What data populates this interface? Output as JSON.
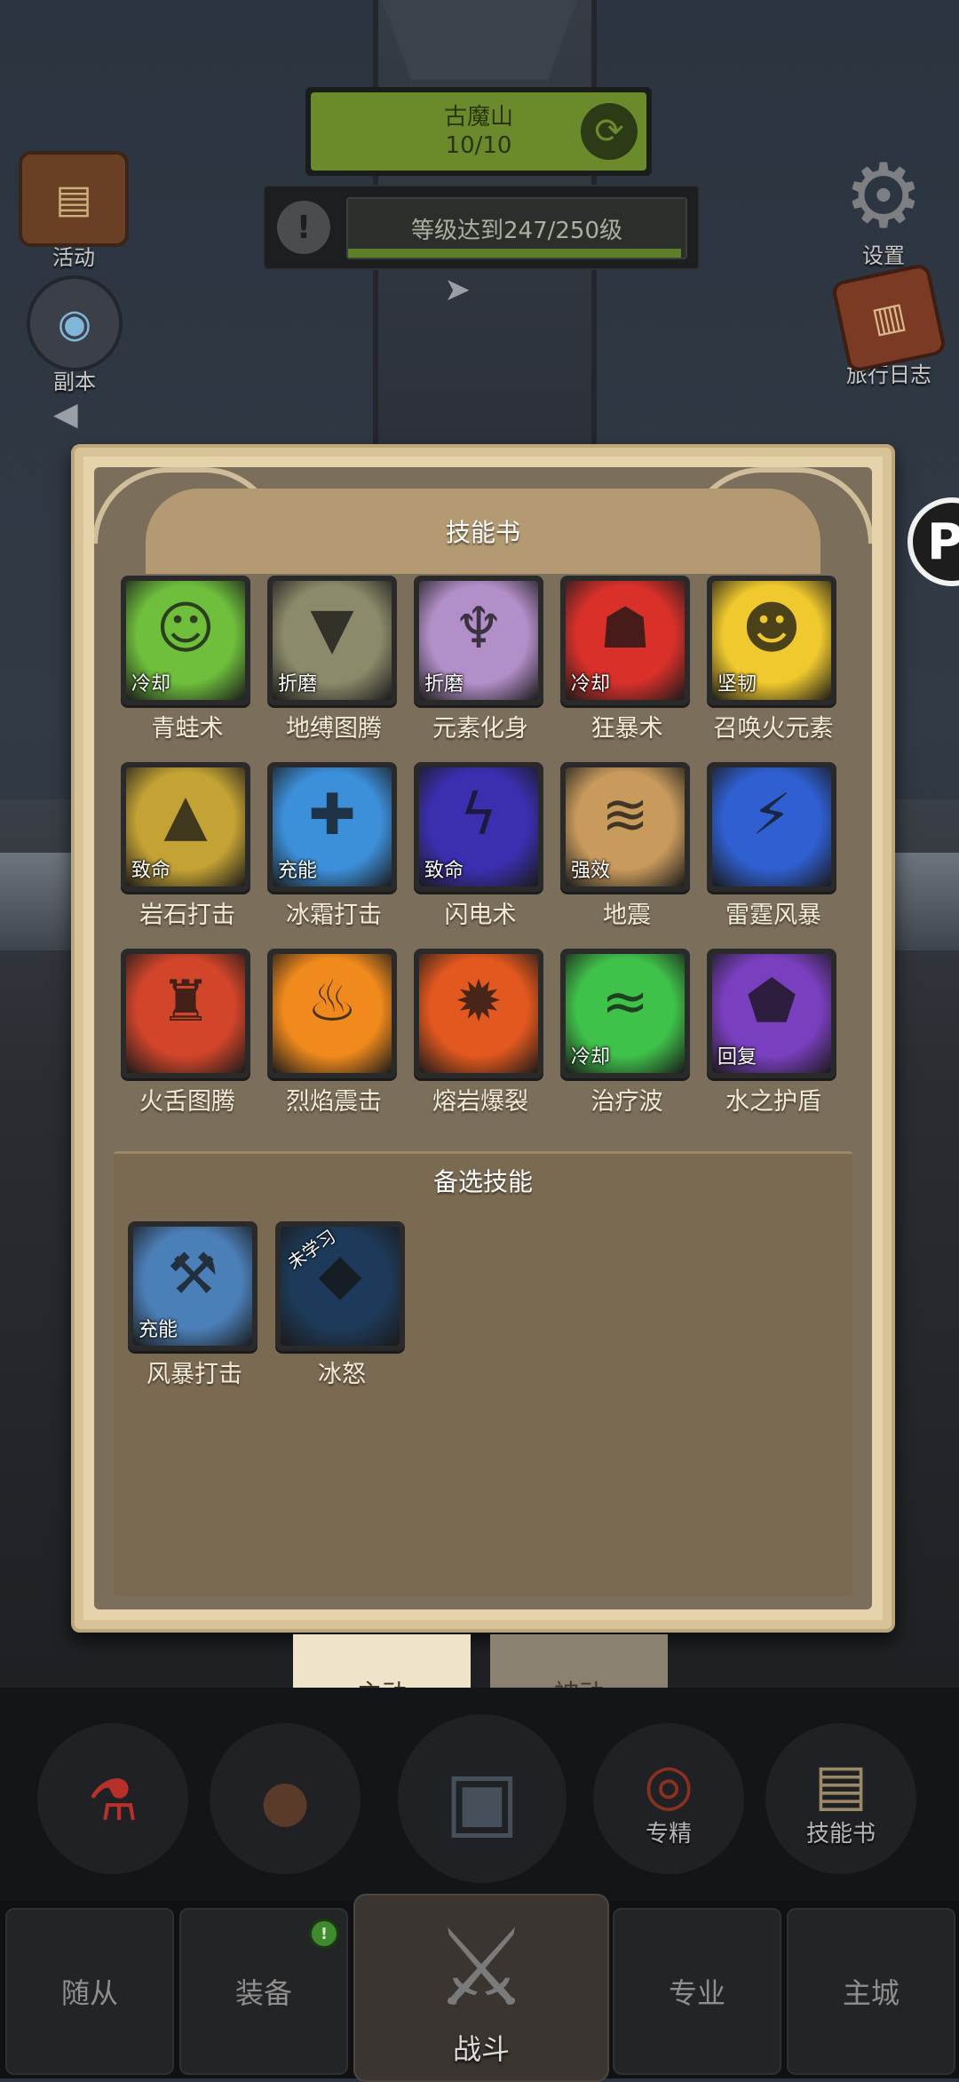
{
  "hud": {
    "stage_name": "古魔山",
    "stage_progress": "10/10",
    "quest_text": "等级达到247/250级",
    "quest_progress_fraction": 0.988
  },
  "side_menu": {
    "left": [
      {
        "label": "活动",
        "icon": "event-scroll-icon"
      },
      {
        "label": "副本",
        "icon": "dungeon-portal-icon"
      }
    ],
    "right": [
      {
        "label": "设置",
        "icon": "gear-icon"
      },
      {
        "label": "旅行日志",
        "icon": "journal-book-icon"
      }
    ]
  },
  "panel": {
    "title": "技能书",
    "alt_title": "备选技能"
  },
  "skills": [
    {
      "name": "青蛙术",
      "tag": "冷却",
      "icon": "frog-icon",
      "color": "#6fbf3c"
    },
    {
      "name": "地缚图腾",
      "tag": "折磨",
      "icon": "earthbind-totem-icon",
      "color": "#8b8a6a"
    },
    {
      "name": "元素化身",
      "tag": "折磨",
      "icon": "elemental-avatar-icon",
      "color": "#b38fc9"
    },
    {
      "name": "狂暴术",
      "tag": "冷却",
      "icon": "bloodlust-mask-icon",
      "color": "#d9302a"
    },
    {
      "name": "召唤火元素",
      "tag": "坚韧",
      "icon": "fire-elemental-icon",
      "color": "#f0c92e"
    },
    {
      "name": "岩石打击",
      "tag": "致命",
      "icon": "rock-strike-icon",
      "color": "#c4a234"
    },
    {
      "name": "冰霜打击",
      "tag": "充能",
      "icon": "frost-strike-icon",
      "color": "#3c8fd9"
    },
    {
      "name": "闪电术",
      "tag": "致命",
      "icon": "lightning-bolt-icon",
      "color": "#3b2fb0"
    },
    {
      "name": "地震",
      "tag": "强效",
      "icon": "earthquake-icon",
      "color": "#c89a5c"
    },
    {
      "name": "雷霆风暴",
      "tag": "",
      "icon": "thunderstorm-icon",
      "color": "#2f5fd0"
    },
    {
      "name": "火舌图腾",
      "tag": "",
      "icon": "flametongue-totem-icon",
      "color": "#d2452a"
    },
    {
      "name": "烈焰震击",
      "tag": "",
      "icon": "flame-shock-icon",
      "color": "#f08a1c"
    },
    {
      "name": "熔岩爆裂",
      "tag": "",
      "icon": "lava-burst-icon",
      "color": "#e2581e"
    },
    {
      "name": "治疗波",
      "tag": "冷却",
      "icon": "healing-wave-icon",
      "color": "#3fc24a"
    },
    {
      "name": "水之护盾",
      "tag": "回复",
      "icon": "water-shield-icon",
      "color": "#7a3fbf"
    }
  ],
  "alt_skills": [
    {
      "name": "风暴打击",
      "tag": "充能",
      "icon": "storm-hammer-icon",
      "color": "#4b7fb8"
    },
    {
      "name": "冰怒",
      "tag": "未学习",
      "icon": "ice-shard-icon",
      "color": "#1e3a5a"
    }
  ],
  "tabs": {
    "active": "主动",
    "passive": "被动"
  },
  "actions": [
    {
      "label": "",
      "icon": "potion-icon"
    },
    {
      "label": "",
      "icon": "bread-icon"
    },
    {
      "label": "",
      "icon": "treasure-chest-icon"
    },
    {
      "label": "专精",
      "icon": "specialization-icon"
    },
    {
      "label": "技能书",
      "icon": "skill-book-icon"
    }
  ],
  "bottom_nav": {
    "followers": "随从",
    "equipment": "装备",
    "equipment_badge": "!",
    "battle": "战斗",
    "profession": "专业",
    "main_city": "主城"
  },
  "colors": {
    "accent_green": "#6b8a2b",
    "panel_parchment": "#e6d3ac",
    "panel_inner": "#7b6e5a"
  }
}
